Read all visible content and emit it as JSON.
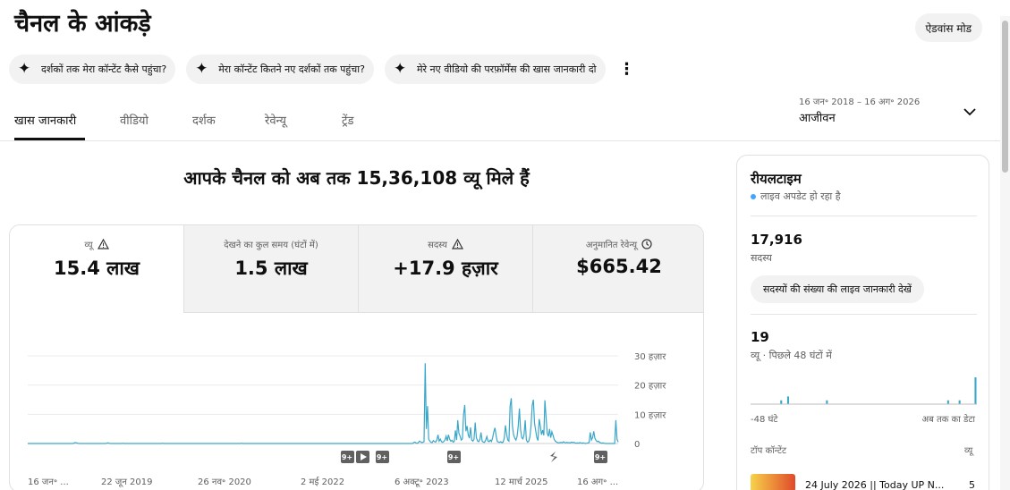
{
  "page": {
    "title": "चैनल के आंकड़े",
    "advanced_mode": "ऐडवांस मोड"
  },
  "chips": [
    {
      "label": "दर्शकों तक मेरा कॉन्टेंट कैसे पहुंचा?"
    },
    {
      "label": "मेरा कॉन्टेंट कितने नए दर्शकों तक पहुंचा?"
    },
    {
      "label": "मेरे नए वीडियो की परफ़ॉर्मेंस की खास जानकारी दो"
    }
  ],
  "date_range": {
    "sub": "16 जन॰ 2018 – 16 अग॰ 2026",
    "main": "आजीवन"
  },
  "tabs": [
    {
      "label": "खास जानकारी",
      "active": true
    },
    {
      "label": "वीडियो"
    },
    {
      "label": "दर्शक"
    },
    {
      "label": "रेवेन्यू"
    },
    {
      "label": "ट्रेंड"
    }
  ],
  "headline": "आपके चैनल को अब तक 15,36,108 व्यू मिले हैं",
  "metrics": [
    {
      "label": "व्यू",
      "value": "15.4 लाख",
      "icon": "warning-icon"
    },
    {
      "label": "देखने का कुल समय (घंटों में)",
      "value": "1.5 लाख"
    },
    {
      "label": "सदस्य",
      "value": "+17.9 हज़ार",
      "icon": "warning-icon"
    },
    {
      "label": "अनुमानित रेवेन्यू",
      "value": "$665.42",
      "icon": "clock-icon"
    }
  ],
  "chart_data": {
    "type": "line",
    "color": "#3aa7c9",
    "ylim": [
      0,
      30000
    ],
    "ytick_labels": [
      "30 हज़ार",
      "20 हज़ार",
      "10 हज़ार",
      "0"
    ],
    "ytick_values": [
      30000,
      20000,
      10000,
      0
    ],
    "xtick_labels": [
      "16 जन॰ ...",
      "22 जून 2019",
      "26 नव॰ 2020",
      "2 मई 2022",
      "6 अक्टू॰ 2023",
      "12 मार्च 2025",
      "16 अग॰ ..."
    ],
    "marker_labels": [
      "9+",
      "9+",
      "9+",
      "9+"
    ],
    "y": [
      0,
      0,
      0,
      0,
      0,
      0,
      0,
      0,
      0,
      0,
      0,
      0,
      0,
      0,
      0,
      0,
      0,
      0,
      0,
      0,
      0,
      0,
      0,
      0,
      0,
      0,
      0,
      0,
      0,
      0,
      0,
      0,
      0,
      0,
      0,
      0,
      0,
      0,
      0,
      0,
      200,
      300,
      200,
      100,
      0,
      0,
      0,
      0,
      0,
      0,
      0,
      0,
      0,
      0,
      0,
      0,
      0,
      0,
      0,
      0,
      0,
      0,
      0,
      0,
      0,
      0,
      0,
      0,
      100,
      200,
      100,
      0,
      0,
      0,
      0,
      0,
      0,
      0,
      0,
      0,
      0,
      0,
      100,
      0,
      0,
      0,
      0,
      0,
      0,
      0,
      0,
      0,
      0,
      0,
      0,
      0,
      0,
      0,
      0,
      0,
      0,
      0,
      0,
      0,
      0,
      0,
      0,
      0,
      0,
      0,
      0,
      0,
      0,
      0,
      0,
      0,
      100,
      0,
      0,
      0,
      0,
      0,
      0,
      0,
      0,
      0,
      0,
      0,
      0,
      0,
      0,
      0,
      0,
      0,
      0,
      0,
      0,
      0,
      0,
      0,
      0,
      0,
      0,
      0,
      0,
      0,
      0,
      0,
      0,
      0,
      0,
      0,
      0,
      0,
      0,
      0,
      0,
      0,
      0,
      0,
      0,
      0,
      0,
      0,
      0,
      0,
      0,
      0,
      0,
      0,
      0,
      0,
      0,
      0,
      0,
      0,
      0,
      0,
      0,
      0,
      0,
      0,
      0,
      0,
      100,
      0,
      0,
      0,
      0,
      0,
      0,
      0,
      0,
      0,
      0,
      0,
      0,
      0,
      0,
      0,
      0,
      0,
      0,
      0,
      0,
      0,
      0,
      0,
      0,
      0,
      0,
      0,
      0,
      0,
      0,
      0,
      0,
      0,
      0,
      0,
      0,
      0,
      0,
      0,
      0,
      0,
      0,
      0,
      0,
      0,
      0,
      0,
      0,
      0,
      0,
      0,
      0,
      0,
      0,
      0,
      0,
      0,
      0,
      0,
      0,
      0,
      0,
      0,
      0,
      0,
      0,
      0,
      0,
      0,
      0,
      0,
      0,
      0,
      0,
      0,
      0,
      0,
      0,
      0,
      0,
      0,
      0,
      0,
      0,
      0,
      0,
      0,
      0,
      0,
      0,
      0,
      0,
      0,
      0,
      0,
      0,
      0,
      0,
      0,
      0,
      0,
      0,
      0,
      0,
      0,
      0,
      0,
      0,
      0,
      0,
      0,
      0,
      0,
      0,
      0,
      0,
      0,
      0,
      0,
      0,
      0,
      0,
      0,
      0,
      0,
      0,
      0,
      0,
      0,
      0,
      0,
      0,
      0,
      0,
      0,
      0,
      0,
      0,
      0,
      0,
      0,
      0,
      0,
      0,
      0,
      0,
      0,
      300,
      500,
      200,
      100,
      200,
      800,
      600,
      300,
      400,
      600,
      27500,
      5000,
      12800,
      1500,
      800,
      400,
      300,
      1000,
      600,
      500,
      1200,
      3000,
      800,
      1500,
      600,
      400,
      700,
      1200,
      2500,
      900,
      3000,
      1500,
      800,
      1100,
      500,
      700,
      4500,
      1200,
      8000,
      3500,
      2500,
      1200,
      1600,
      10000,
      13200,
      4200,
      6000,
      3000,
      1800,
      5500,
      1200,
      800,
      1500,
      7200,
      2000,
      900,
      600,
      1400,
      3800,
      800,
      500,
      400,
      1200,
      2400,
      800,
      600,
      1200,
      700,
      2000,
      4000,
      5400,
      2600,
      700,
      500,
      400,
      600,
      300,
      500,
      1800,
      6200,
      3200,
      1200,
      800,
      12800,
      15500,
      6000,
      3000,
      1800,
      1200,
      2400,
      6000,
      12000,
      4800,
      2000,
      1600,
      3000,
      8000,
      1200,
      500,
      700,
      2200,
      6000,
      13000,
      15000,
      7000,
      4400,
      2000,
      1000,
      8400,
      6000,
      3000,
      4600,
      2800,
      14800,
      9000,
      3500,
      2400,
      5000,
      2000,
      4000,
      2800,
      1400,
      800,
      500,
      300,
      200,
      300,
      400,
      200,
      600,
      300,
      200,
      400,
      200,
      300,
      200,
      500,
      300,
      400,
      200,
      100,
      200,
      100,
      300,
      200,
      100,
      200,
      100,
      0,
      100,
      200,
      300,
      3800,
      1200,
      2000,
      4200,
      1800,
      1000,
      600,
      800,
      400,
      200,
      100,
      200,
      100,
      0,
      0,
      0,
      0,
      0,
      0,
      0,
      0,
      0,
      8000,
      1500,
      500
    ]
  },
  "realtime": {
    "title": "रीयलटाइम",
    "live_text": "लाइव अपडेट हो रहा है",
    "subscribers": "17,916",
    "subscribers_label": "सदस्य",
    "live_button": "सदस्यों की संख्या की लाइव जानकारी देखें",
    "views": "19",
    "views_label": "व्यू · पिछले 48 घंटों में",
    "axis_start": "-48 घंटे",
    "axis_end": "अब तक का डेटा",
    "top_content": "टॉप कॉन्टेंट",
    "top_content_metric": "व्यू",
    "top_item_title": "24 July 2026 || Today UP N...",
    "top_item_value": "5",
    "bars": [
      0,
      0,
      0,
      0,
      0,
      0,
      0,
      0,
      0,
      0,
      0,
      0,
      0,
      1,
      0,
      0,
      2,
      0,
      0,
      0,
      0,
      0,
      0,
      0,
      0,
      0,
      0,
      0,
      0,
      0,
      0,
      0,
      0,
      1,
      0,
      0,
      0,
      0,
      0,
      0,
      0,
      0,
      0,
      0,
      0,
      0,
      0,
      0,
      0,
      0,
      0,
      0,
      0,
      0,
      0,
      0,
      0,
      0,
      0,
      0,
      0,
      0,
      0,
      0,
      0,
      0,
      0,
      0,
      0,
      0,
      0,
      0,
      0,
      0,
      0,
      0,
      0,
      0,
      0,
      0,
      0,
      0,
      0,
      0,
      0,
      0,
      1,
      0,
      0,
      0,
      0,
      1,
      0,
      0,
      0,
      0,
      0,
      0,
      7
    ]
  }
}
